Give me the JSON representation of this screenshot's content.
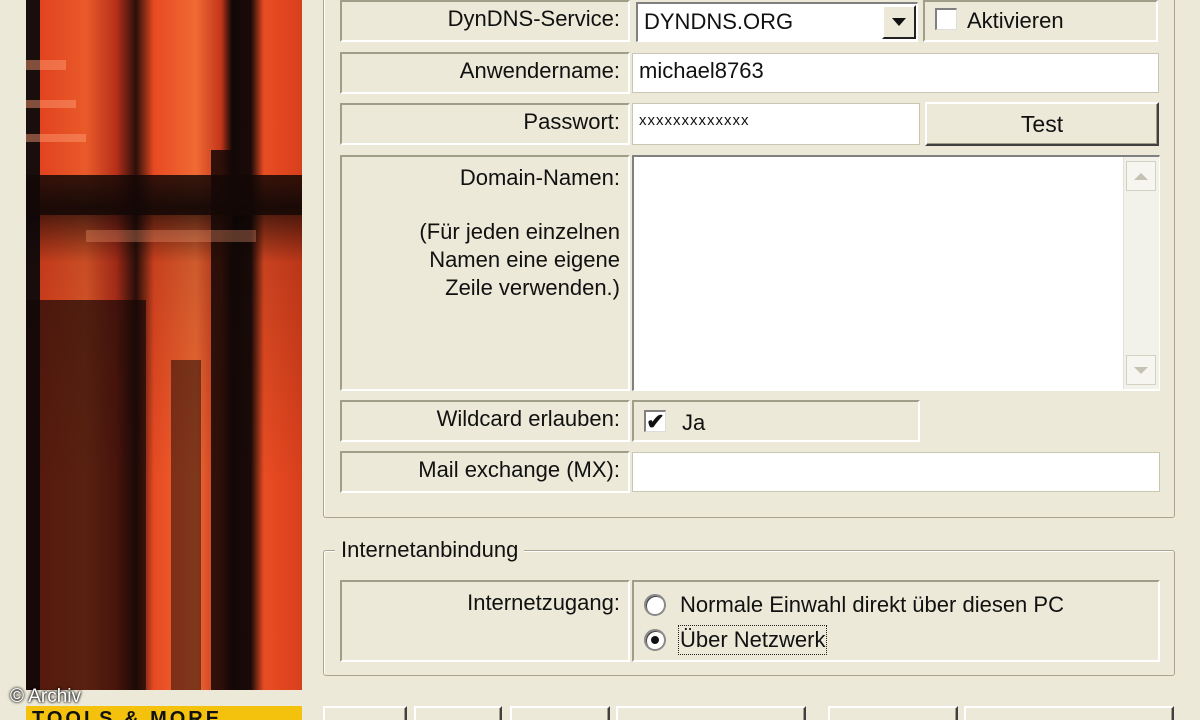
{
  "left_panel": {
    "copyright": "© Archiv",
    "brand_text": "TOOLS & MORE"
  },
  "dyndns": {
    "service_label": "DynDNS-Service:",
    "service_value": "DYNDNS.ORG",
    "activate_label": "Aktivieren",
    "activate_checked": false,
    "username_label": "Anwendername:",
    "username_value": "michael8763",
    "password_label": "Passwort:",
    "password_value": "xxxxxxxxxxxxx",
    "test_button": "Test",
    "domain_label": "Domain-Namen:",
    "domain_hint_line1": "(Für jeden einzelnen",
    "domain_hint_line2": "Namen eine eigene",
    "domain_hint_line3": "Zeile verwenden.)",
    "domain_value": "",
    "wildcard_label": "Wildcard erlauben:",
    "wildcard_option": "Ja",
    "wildcard_checked": true,
    "mx_label": "Mail exchange (MX):",
    "mx_value": ""
  },
  "connection": {
    "group_title": "Internetanbindung",
    "access_label": "Internetzugang:",
    "options": [
      {
        "label": "Normale Einwahl direkt über diesen PC",
        "selected": false
      },
      {
        "label": "Über Netzwerk",
        "selected": true
      }
    ]
  },
  "icons": {
    "combo_arrow": "chevron-down-icon",
    "checkbox": "checkbox-icon",
    "radio": "radio-icon"
  }
}
